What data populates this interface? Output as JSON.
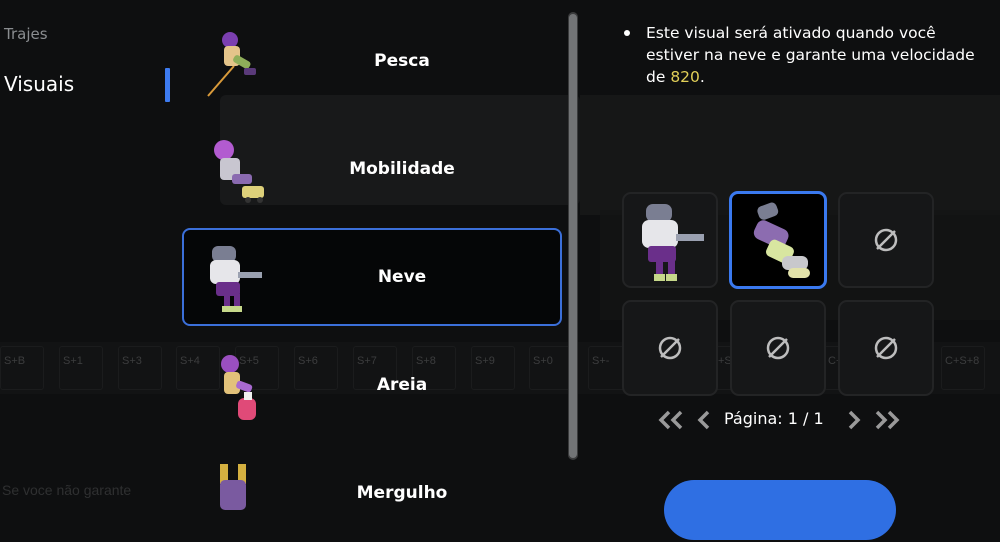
{
  "sidebar": {
    "category_label": "Trajes",
    "items": [
      {
        "label": "Visuais",
        "active": true
      }
    ]
  },
  "list": {
    "items": [
      {
        "label": "Pesca",
        "icon": "fishing-outfit-icon"
      },
      {
        "label": "Mobilidade",
        "icon": "mobility-outfit-icon"
      },
      {
        "label": "Neve",
        "icon": "snow-outfit-icon",
        "selected": true
      },
      {
        "label": "Areia",
        "icon": "sand-outfit-icon"
      },
      {
        "label": "Mergulho",
        "icon": "diving-outfit-icon"
      }
    ]
  },
  "description": {
    "text_before": "Este visual será ativado quando você estiver na neve e garante uma velocidade de ",
    "speed_value": "820",
    "text_after": "."
  },
  "variants": {
    "slots": [
      {
        "state": "outfit",
        "icon": "snow-outfit-variant-icon"
      },
      {
        "state": "selected",
        "icon": "snow-outfit-flying-icon"
      },
      {
        "state": "empty",
        "icon": "empty-slot-icon"
      },
      {
        "state": "empty",
        "icon": "empty-slot-icon"
      },
      {
        "state": "empty",
        "icon": "empty-slot-icon"
      },
      {
        "state": "empty",
        "icon": "empty-slot-icon"
      }
    ]
  },
  "pagination": {
    "label": "Página: 1 / 1"
  },
  "background": {
    "hotbar_labels": [
      "S+B",
      "S+1",
      "S+3",
      "S+4",
      "S+5",
      "S+6",
      "S+7",
      "S+8",
      "S+9",
      "S+0",
      "S+-",
      "S",
      "C+S+4",
      "C+S+5",
      "C+S+6",
      "C+S+7",
      "C+S+8"
    ],
    "faded_text": "Se voce não garante"
  },
  "colors": {
    "accent": "#3d7bf0",
    "highlight_value": "#e1cf58",
    "selected_border": "#3b6fd9"
  }
}
